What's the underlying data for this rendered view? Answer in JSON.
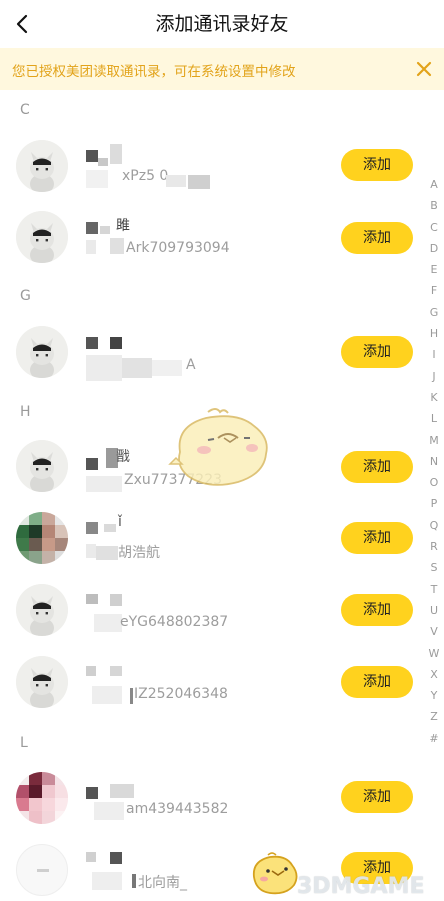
{
  "header": {
    "title": "添加通讯录好友",
    "back_icon": "chevron-left-icon"
  },
  "notice": {
    "text": "您已授权美团读取通讯录，可在系统设置中修改",
    "close_icon": "close-icon",
    "color": "#e2a31a"
  },
  "sections": {
    "c": "C",
    "g": "G",
    "h": "H",
    "l": "L"
  },
  "contacts": [
    {
      "line2": "xPz5            0",
      "button": "添加"
    },
    {
      "line1": "雎",
      "line2": "Ark709793094",
      "button": "添加"
    },
    {
      "line1": "",
      "line2": "A",
      "button": "添加"
    },
    {
      "line1": "戬",
      "line2": "Zxu77377223",
      "button": "添加"
    },
    {
      "line1": "ǐ",
      "line2": "胡浩航",
      "button": "添加"
    },
    {
      "line2": "eYG648802387",
      "button": "添加"
    },
    {
      "line2": "IZ252046348",
      "button": "添加"
    },
    {
      "line2": "am439443582",
      "button": "添加"
    },
    {
      "line2": "北向南_",
      "button": "添加"
    }
  ],
  "index_letters": [
    "A",
    "B",
    "C",
    "D",
    "E",
    "F",
    "G",
    "H",
    "I",
    "J",
    "K",
    "L",
    "M",
    "N",
    "O",
    "P",
    "Q",
    "R",
    "S",
    "T",
    "U",
    "V",
    "W",
    "X",
    "Y",
    "Z",
    "#"
  ],
  "watermark": {
    "text": "3DMGAME"
  },
  "accent_color": "#ffd21e"
}
